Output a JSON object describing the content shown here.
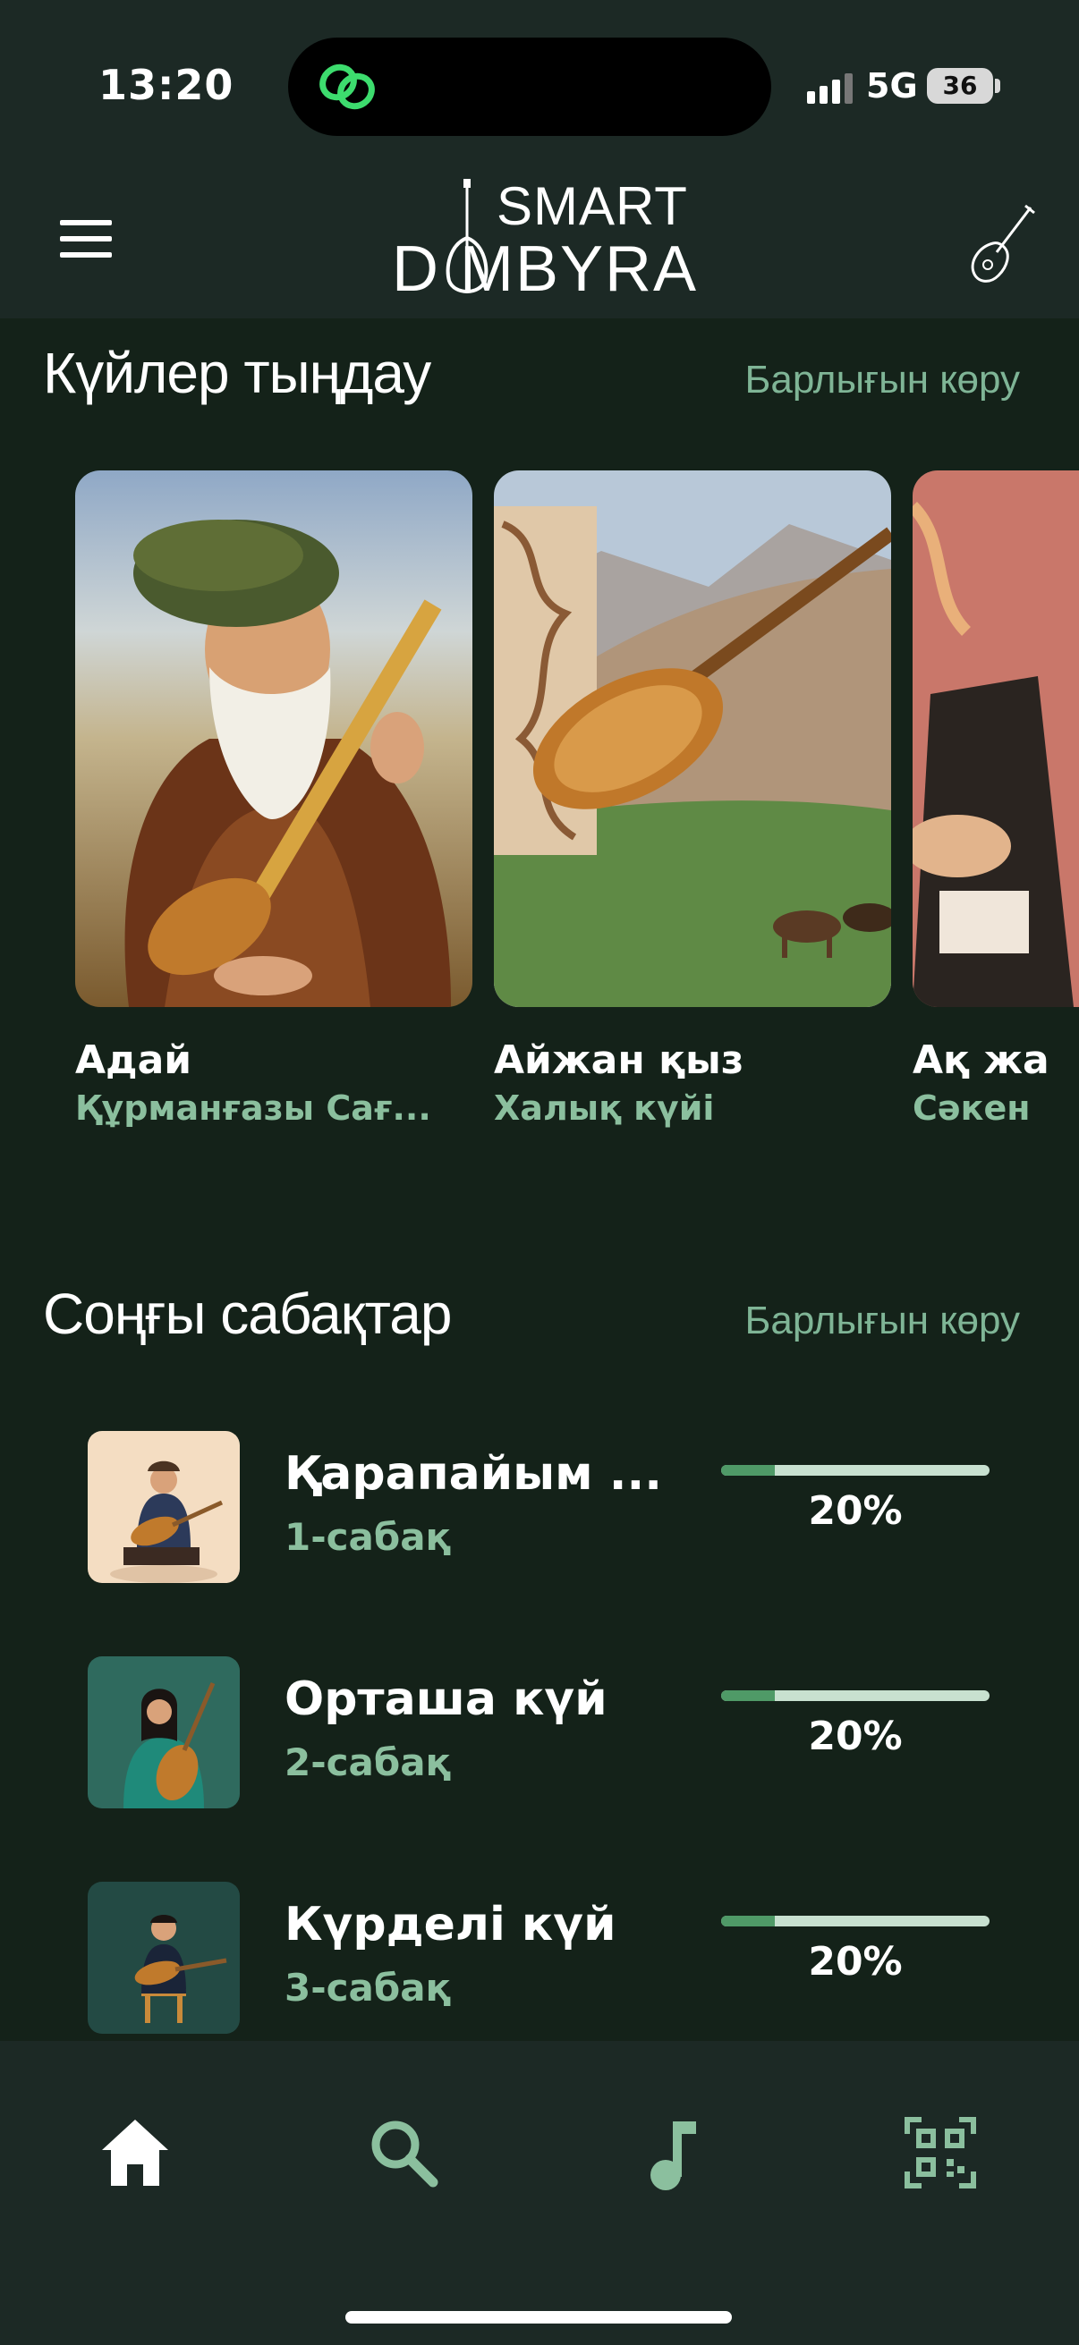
{
  "status_bar": {
    "time": "13:20",
    "network": "5G",
    "battery": "36"
  },
  "header": {
    "logo_top": "SMART",
    "logo_main": "D MBYRA",
    "logo_alt": "SMART DOMBYRA"
  },
  "listen_section": {
    "title": "Күйлер тыңдау",
    "see_all": "Барлығын көру",
    "cards": [
      {
        "title": "Адай",
        "subtitle": "Құрманғазы Сағ..."
      },
      {
        "title": "Айжан қыз",
        "subtitle": "Халық күйі"
      },
      {
        "title": "Ақ жа",
        "subtitle": "Сәкен"
      }
    ]
  },
  "lessons_section": {
    "title": "Соңғы сабақтар",
    "see_all": "Барлығын көру",
    "lessons": [
      {
        "title": "Қарапайым ...",
        "subtitle": "1-сабақ",
        "progress": 20,
        "progress_label": "20%"
      },
      {
        "title": "Орташа күй",
        "subtitle": "2-сабақ",
        "progress": 20,
        "progress_label": "20%"
      },
      {
        "title": "Күрделі күй",
        "subtitle": "3-сабақ",
        "progress": 20,
        "progress_label": "20%"
      }
    ]
  },
  "tab_bar": {
    "tabs": [
      {
        "icon": "home-icon",
        "active": true
      },
      {
        "icon": "search-icon",
        "active": false
      },
      {
        "icon": "music-note-icon",
        "active": false
      },
      {
        "icon": "qr-code-icon",
        "active": false
      }
    ]
  },
  "colors": {
    "background": "#142219",
    "bar": "#1c2925",
    "accent": "#8bbf9e",
    "progress_fill": "#4f9a67",
    "progress_track": "#c8e1d0"
  }
}
